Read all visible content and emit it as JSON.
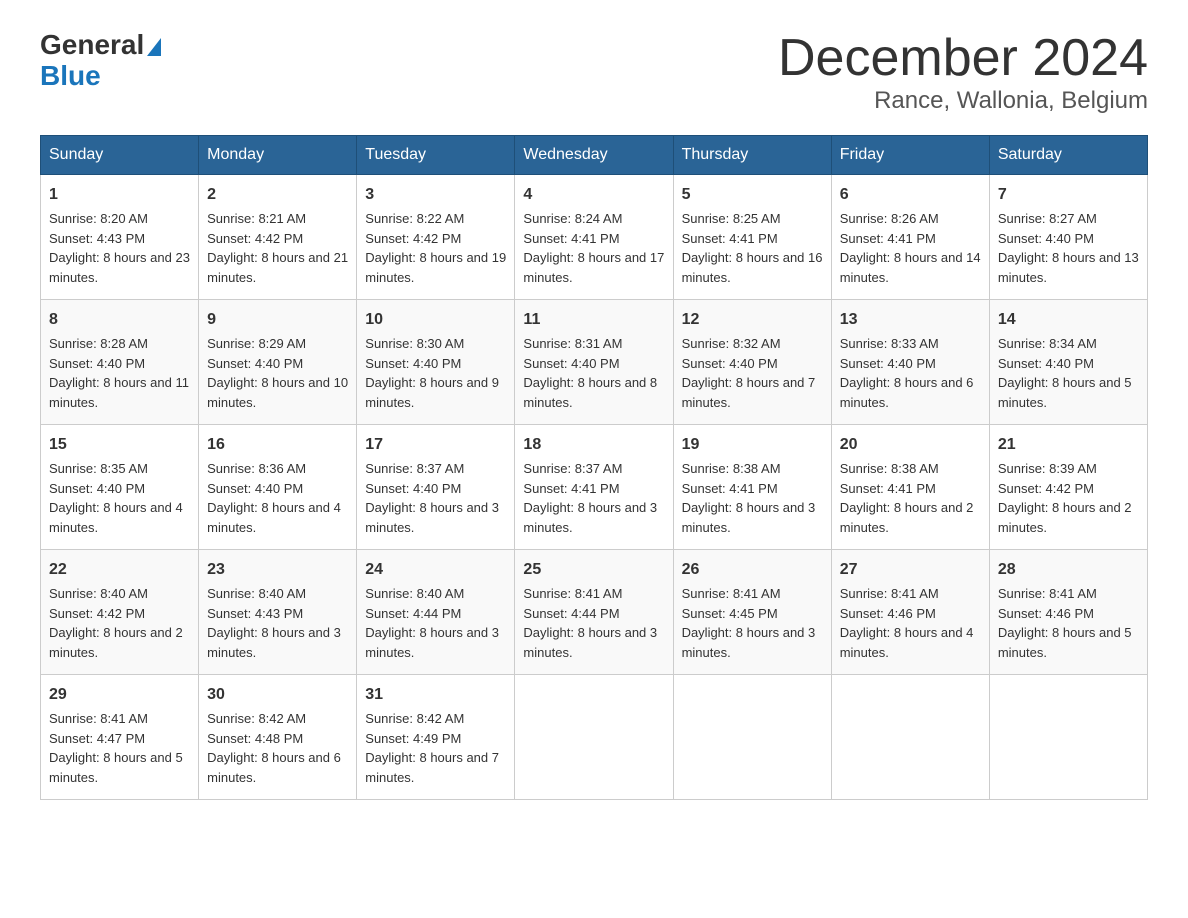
{
  "header": {
    "logo_general": "General",
    "logo_blue": "Blue",
    "month": "December 2024",
    "location": "Rance, Wallonia, Belgium"
  },
  "days_of_week": [
    "Sunday",
    "Monday",
    "Tuesday",
    "Wednesday",
    "Thursday",
    "Friday",
    "Saturday"
  ],
  "weeks": [
    [
      {
        "day": "1",
        "sunrise": "8:20 AM",
        "sunset": "4:43 PM",
        "daylight": "8 hours and 23 minutes."
      },
      {
        "day": "2",
        "sunrise": "8:21 AM",
        "sunset": "4:42 PM",
        "daylight": "8 hours and 21 minutes."
      },
      {
        "day": "3",
        "sunrise": "8:22 AM",
        "sunset": "4:42 PM",
        "daylight": "8 hours and 19 minutes."
      },
      {
        "day": "4",
        "sunrise": "8:24 AM",
        "sunset": "4:41 PM",
        "daylight": "8 hours and 17 minutes."
      },
      {
        "day": "5",
        "sunrise": "8:25 AM",
        "sunset": "4:41 PM",
        "daylight": "8 hours and 16 minutes."
      },
      {
        "day": "6",
        "sunrise": "8:26 AM",
        "sunset": "4:41 PM",
        "daylight": "8 hours and 14 minutes."
      },
      {
        "day": "7",
        "sunrise": "8:27 AM",
        "sunset": "4:40 PM",
        "daylight": "8 hours and 13 minutes."
      }
    ],
    [
      {
        "day": "8",
        "sunrise": "8:28 AM",
        "sunset": "4:40 PM",
        "daylight": "8 hours and 11 minutes."
      },
      {
        "day": "9",
        "sunrise": "8:29 AM",
        "sunset": "4:40 PM",
        "daylight": "8 hours and 10 minutes."
      },
      {
        "day": "10",
        "sunrise": "8:30 AM",
        "sunset": "4:40 PM",
        "daylight": "8 hours and 9 minutes."
      },
      {
        "day": "11",
        "sunrise": "8:31 AM",
        "sunset": "4:40 PM",
        "daylight": "8 hours and 8 minutes."
      },
      {
        "day": "12",
        "sunrise": "8:32 AM",
        "sunset": "4:40 PM",
        "daylight": "8 hours and 7 minutes."
      },
      {
        "day": "13",
        "sunrise": "8:33 AM",
        "sunset": "4:40 PM",
        "daylight": "8 hours and 6 minutes."
      },
      {
        "day": "14",
        "sunrise": "8:34 AM",
        "sunset": "4:40 PM",
        "daylight": "8 hours and 5 minutes."
      }
    ],
    [
      {
        "day": "15",
        "sunrise": "8:35 AM",
        "sunset": "4:40 PM",
        "daylight": "8 hours and 4 minutes."
      },
      {
        "day": "16",
        "sunrise": "8:36 AM",
        "sunset": "4:40 PM",
        "daylight": "8 hours and 4 minutes."
      },
      {
        "day": "17",
        "sunrise": "8:37 AM",
        "sunset": "4:40 PM",
        "daylight": "8 hours and 3 minutes."
      },
      {
        "day": "18",
        "sunrise": "8:37 AM",
        "sunset": "4:41 PM",
        "daylight": "8 hours and 3 minutes."
      },
      {
        "day": "19",
        "sunrise": "8:38 AM",
        "sunset": "4:41 PM",
        "daylight": "8 hours and 3 minutes."
      },
      {
        "day": "20",
        "sunrise": "8:38 AM",
        "sunset": "4:41 PM",
        "daylight": "8 hours and 2 minutes."
      },
      {
        "day": "21",
        "sunrise": "8:39 AM",
        "sunset": "4:42 PM",
        "daylight": "8 hours and 2 minutes."
      }
    ],
    [
      {
        "day": "22",
        "sunrise": "8:40 AM",
        "sunset": "4:42 PM",
        "daylight": "8 hours and 2 minutes."
      },
      {
        "day": "23",
        "sunrise": "8:40 AM",
        "sunset": "4:43 PM",
        "daylight": "8 hours and 3 minutes."
      },
      {
        "day": "24",
        "sunrise": "8:40 AM",
        "sunset": "4:44 PM",
        "daylight": "8 hours and 3 minutes."
      },
      {
        "day": "25",
        "sunrise": "8:41 AM",
        "sunset": "4:44 PM",
        "daylight": "8 hours and 3 minutes."
      },
      {
        "day": "26",
        "sunrise": "8:41 AM",
        "sunset": "4:45 PM",
        "daylight": "8 hours and 3 minutes."
      },
      {
        "day": "27",
        "sunrise": "8:41 AM",
        "sunset": "4:46 PM",
        "daylight": "8 hours and 4 minutes."
      },
      {
        "day": "28",
        "sunrise": "8:41 AM",
        "sunset": "4:46 PM",
        "daylight": "8 hours and 5 minutes."
      }
    ],
    [
      {
        "day": "29",
        "sunrise": "8:41 AM",
        "sunset": "4:47 PM",
        "daylight": "8 hours and 5 minutes."
      },
      {
        "day": "30",
        "sunrise": "8:42 AM",
        "sunset": "4:48 PM",
        "daylight": "8 hours and 6 minutes."
      },
      {
        "day": "31",
        "sunrise": "8:42 AM",
        "sunset": "4:49 PM",
        "daylight": "8 hours and 7 minutes."
      },
      null,
      null,
      null,
      null
    ]
  ],
  "labels": {
    "sunrise": "Sunrise:",
    "sunset": "Sunset:",
    "daylight": "Daylight:"
  }
}
